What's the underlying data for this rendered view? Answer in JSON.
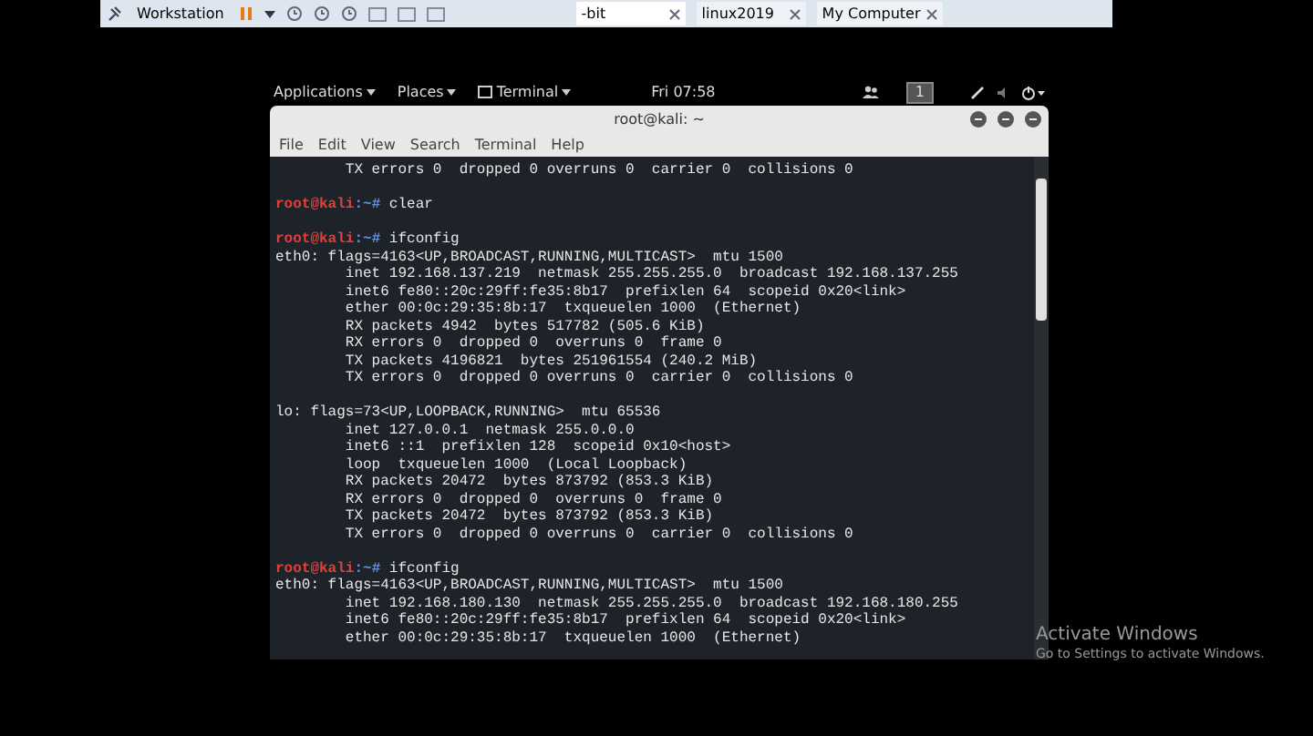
{
  "vm_toolbar": {
    "menu": "Workstation",
    "tabs": [
      {
        "label": "-bit",
        "selected": true
      },
      {
        "label": "linux2019",
        "selected": false
      },
      {
        "label": "My Computer",
        "selected": false
      }
    ]
  },
  "top_bar": {
    "menus": [
      "Applications",
      "Places",
      "Terminal"
    ],
    "clock": "Fri 07:58",
    "workspace": "1"
  },
  "terminal": {
    "title": "root@kali: ~",
    "menu": [
      "File",
      "Edit",
      "View",
      "Search",
      "Terminal",
      "Help"
    ],
    "lines": [
      {
        "kind": "output",
        "text": "        TX errors 0  dropped 0 overruns 0  carrier 0  collisions 0"
      },
      {
        "kind": "blank"
      },
      {
        "kind": "prompt",
        "user": "root@kali",
        "path": ":~#",
        "command": "clear"
      },
      {
        "kind": "blank"
      },
      {
        "kind": "prompt",
        "user": "root@kali",
        "path": ":~#",
        "command": "ifconfig"
      },
      {
        "kind": "output",
        "text": "eth0: flags=4163<UP,BROADCAST,RUNNING,MULTICAST>  mtu 1500"
      },
      {
        "kind": "output",
        "text": "        inet 192.168.137.219  netmask 255.255.255.0  broadcast 192.168.137.255"
      },
      {
        "kind": "output",
        "text": "        inet6 fe80::20c:29ff:fe35:8b17  prefixlen 64  scopeid 0x20<link>"
      },
      {
        "kind": "output",
        "text": "        ether 00:0c:29:35:8b:17  txqueuelen 1000  (Ethernet)"
      },
      {
        "kind": "output",
        "text": "        RX packets 4942  bytes 517782 (505.6 KiB)"
      },
      {
        "kind": "output",
        "text": "        RX errors 0  dropped 0  overruns 0  frame 0"
      },
      {
        "kind": "output",
        "text": "        TX packets 4196821  bytes 251961554 (240.2 MiB)"
      },
      {
        "kind": "output",
        "text": "        TX errors 0  dropped 0 overruns 0  carrier 0  collisions 0"
      },
      {
        "kind": "blank"
      },
      {
        "kind": "output",
        "text": "lo: flags=73<UP,LOOPBACK,RUNNING>  mtu 65536"
      },
      {
        "kind": "output",
        "text": "        inet 127.0.0.1  netmask 255.0.0.0"
      },
      {
        "kind": "output",
        "text": "        inet6 ::1  prefixlen 128  scopeid 0x10<host>"
      },
      {
        "kind": "output",
        "text": "        loop  txqueuelen 1000  (Local Loopback)"
      },
      {
        "kind": "output",
        "text": "        RX packets 20472  bytes 873792 (853.3 KiB)"
      },
      {
        "kind": "output",
        "text": "        RX errors 0  dropped 0  overruns 0  frame 0"
      },
      {
        "kind": "output",
        "text": "        TX packets 20472  bytes 873792 (853.3 KiB)"
      },
      {
        "kind": "output",
        "text": "        TX errors 0  dropped 0 overruns 0  carrier 0  collisions 0"
      },
      {
        "kind": "blank"
      },
      {
        "kind": "prompt",
        "user": "root@kali",
        "path": ":~#",
        "command": "ifconfig"
      },
      {
        "kind": "output",
        "text": "eth0: flags=4163<UP,BROADCAST,RUNNING,MULTICAST>  mtu 1500"
      },
      {
        "kind": "output",
        "text": "        inet 192.168.180.130  netmask 255.255.255.0  broadcast 192.168.180.255"
      },
      {
        "kind": "output",
        "text": "        inet6 fe80::20c:29ff:fe35:8b17  prefixlen 64  scopeid 0x20<link>"
      },
      {
        "kind": "output",
        "text": "        ether 00:0c:29:35:8b:17  txqueuelen 1000  (Ethernet)"
      }
    ]
  },
  "activation_notice": {
    "title": "Activate Windows",
    "text": "Go to Settings to activate Windows."
  }
}
